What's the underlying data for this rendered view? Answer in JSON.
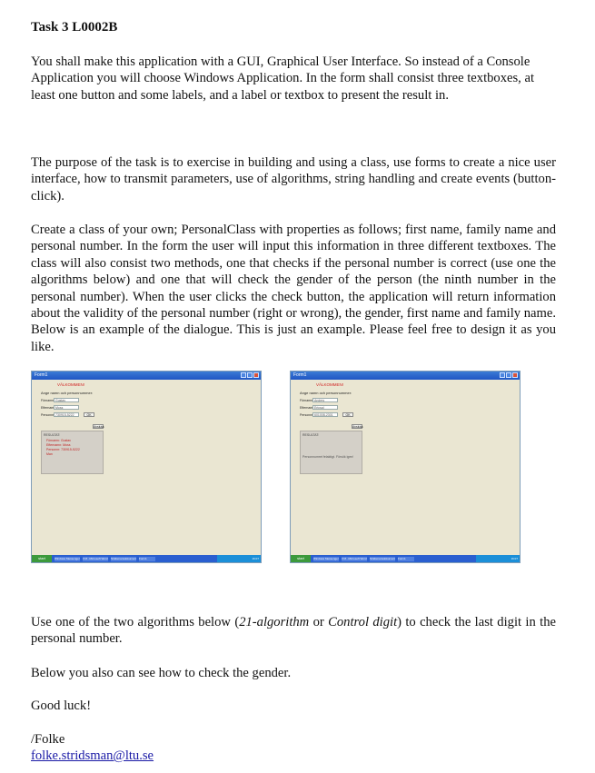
{
  "title": "Task 3 L0002B",
  "para1": "You shall make this application with a GUI, Graphical User Interface. So instead of a Console Application you will choose Windows Application. In the form shall consist three textboxes, at least one button and some labels, and a label or textbox to present the result in.",
  "para2": "The purpose of the task is to exercise in building and using a class, use forms to create a nice user interface, how to transmit parameters, use of algorithms, string handling and create events (button-click).",
  "para3": "Create a class of your own; PersonalClass with properties as follows; first name, family name and personal number. In the form the user will input this information in three different textboxes. The class will also consist two methods, one that checks if the personal number is correct (use one the algorithms below) and one that will check the gender of the person (the ninth number in the personal number). When the user clicks the check button, the application will return information about the validity of the personal number (right or wrong), the gender, first name and family name. Below is an example of the dialogue. This is just an example. Please feel free to design it as you like.",
  "para4": {
    "before": "Use one of the two algorithms below (",
    "alg1": "21-algorithm",
    "mid": " or ",
    "alg2": "Control digit",
    "after": ") to check the last digit in the personal number."
  },
  "para5": "Below you also can see how to check the gender.",
  "para6": "Good luck!",
  "signature": "/Folke",
  "email": "folke.stridsman@ltu.se",
  "screenshots": [
    {
      "window_title": "Form1",
      "welcome": "VÄLKOMMEN!",
      "prompt": "Ange namn och personnummer:",
      "fields": [
        {
          "label": "Förnamn:",
          "value": "Gustav"
        },
        {
          "label": "Efternamn:",
          "value": "Moss"
        },
        {
          "label": "Personnr:",
          "value": "730915-5222"
        }
      ],
      "ok_label": "OK",
      "exit_label": "Avsluta",
      "result_label": "RESULTAT:",
      "result_lines": [
        "Förnamn: Gustav",
        "Efternamn: Moss",
        "Personnr: 730915-5222",
        "Man"
      ],
      "result_message": "",
      "start_label": "start",
      "taskbar_items": [
        "Windows Messenger",
        "3 M...Microsoft Word",
        "Stridsmansdokument",
        "Form1"
      ],
      "tray_time": "16:07"
    },
    {
      "window_title": "Form1",
      "welcome": "VÄLKOMMEN!",
      "prompt": "Ange namn och personnummer:",
      "fields": [
        {
          "label": "Förnamn:",
          "value": "Anders"
        },
        {
          "label": "Efternamn:",
          "value": "Ericsal"
        },
        {
          "label": "Personnr:",
          "value": "601008-2301"
        }
      ],
      "ok_label": "OK",
      "exit_label": "Avsluta",
      "result_label": "RESULTAT:",
      "result_lines": [],
      "result_message": "Personnumret felaktigt. Försök igen!",
      "start_label": "start",
      "taskbar_items": [
        "Windows Messenger",
        "3 M...Microsoft Word",
        "Stridsmansdokument",
        "Form1"
      ],
      "tray_time": "16:07"
    }
  ]
}
